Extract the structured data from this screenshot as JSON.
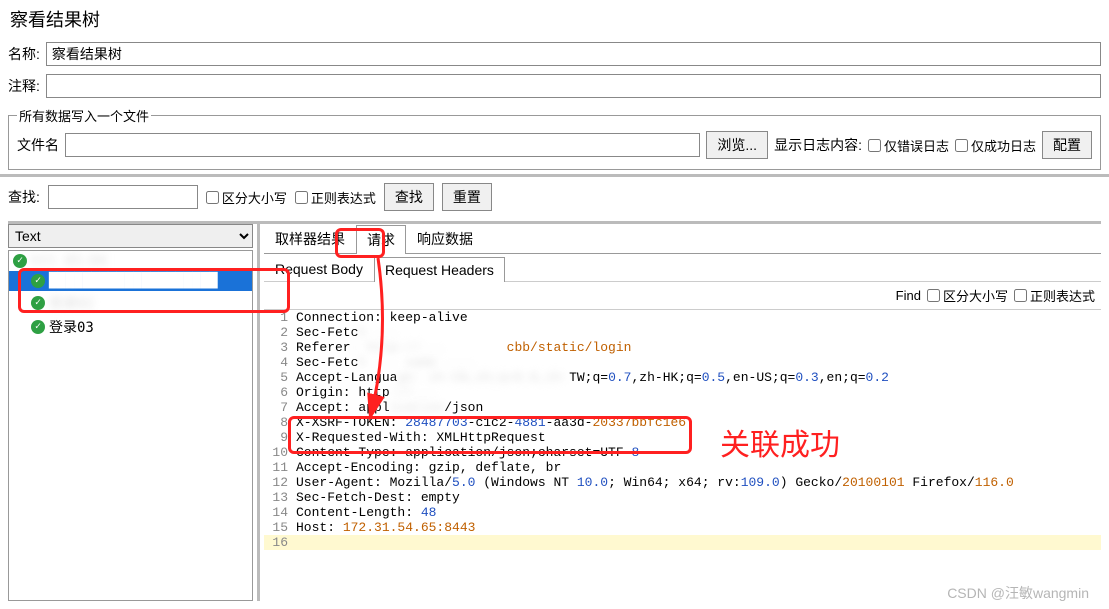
{
  "title": "察看结果树",
  "labels": {
    "name": "名称:",
    "comment": "注释:",
    "writeAll": "所有数据写入一个文件",
    "fileName": "文件名",
    "browse": "浏览...",
    "showLog": "显示日志内容:",
    "errorsOnly": "仅错误日志",
    "successOnly": "仅成功日志",
    "configure": "配置",
    "searchLabel": "查找:",
    "caseSensitive": "区分大小写",
    "regex": "正则表达式",
    "searchBtn": "查找",
    "resetBtn": "重置"
  },
  "nameValue": "察看结果树",
  "tree": {
    "renderer": "Text",
    "items": [
      {
        "label": "htt            65:84",
        "blurred": true,
        "indent": false
      },
      {
        "label": "████████████████████",
        "selected": true,
        "indent": true
      },
      {
        "label": "登录02",
        "blurred": true,
        "indent": true
      },
      {
        "label": "登录03",
        "indent": true
      }
    ]
  },
  "tabs": {
    "main": [
      "取样器结果",
      "请求",
      "响应数据"
    ],
    "mainActive": 1,
    "sub": [
      "Request Body",
      "Request Headers"
    ],
    "subActive": 1,
    "findLabel": "Find",
    "cb1": "区分大小写",
    "cb2": "正则表达式"
  },
  "annotation": "关联成功",
  "watermark": "CSDN @汪敏wangmin",
  "code": [
    {
      "n": 1,
      "segs": [
        {
          "t": "Connection: "
        },
        {
          "t": "keep-alive"
        }
      ]
    },
    {
      "n": 2,
      "segs": [
        {
          "t": "Sec-Fetc"
        },
        {
          "t": "h ...",
          "cls": "blur"
        }
      ]
    },
    {
      "n": 3,
      "segs": [
        {
          "t": "Referer"
        },
        {
          "t": ": http://...        ",
          "cls": "blur"
        },
        {
          "t": "cbb/static/login",
          "cls": "hl-orange"
        }
      ]
    },
    {
      "n": 4,
      "segs": [
        {
          "t": "Sec-Fetc"
        },
        {
          "t": "h ... same ....",
          "cls": "blur"
        }
      ]
    },
    {
      "n": 5,
      "segs": [
        {
          "t": "Accept-Langua"
        },
        {
          "t": "ge: zh-CN,zh;q=0.8,zh-",
          "cls": "blur"
        },
        {
          "t": "TW"
        },
        {
          "t": ";q=",
          "cls": ""
        },
        {
          "t": "0.7",
          "cls": "hl-blue"
        },
        {
          "t": ",zh-HK;q="
        },
        {
          "t": "0.5",
          "cls": "hl-blue"
        },
        {
          "t": ",en-US;q="
        },
        {
          "t": "0.3",
          "cls": "hl-blue"
        },
        {
          "t": ",en;q="
        },
        {
          "t": "0.2",
          "cls": "hl-blue"
        }
      ]
    },
    {
      "n": 6,
      "segs": [
        {
          "t": "Origin: http"
        },
        {
          "t": "://...",
          "cls": "blur"
        }
      ]
    },
    {
      "n": 7,
      "segs": [
        {
          "t": "Accept: appl"
        },
        {
          "t": "ication",
          "cls": "blur"
        },
        {
          "t": "/json"
        }
      ]
    },
    {
      "n": 8,
      "segs": [
        {
          "t": "X-XSRF-TOKEN: "
        },
        {
          "t": "28487703",
          "cls": "hl-blue"
        },
        {
          "t": "-c1c2-"
        },
        {
          "t": "4881",
          "cls": "hl-blue"
        },
        {
          "t": "-aa3d-"
        },
        {
          "t": "20337bbfc1e6",
          "cls": "hl-orange"
        }
      ]
    },
    {
      "n": 9,
      "segs": [
        {
          "t": "X-Requested-With: XMLHttpRequest"
        }
      ]
    },
    {
      "n": 10,
      "segs": [
        {
          "t": "Content-Type: application/json;charset=UTF-"
        },
        {
          "t": "8",
          "cls": "hl-blue"
        }
      ]
    },
    {
      "n": 11,
      "segs": [
        {
          "t": "Accept-Encoding: gzip, deflate, br"
        }
      ]
    },
    {
      "n": 12,
      "segs": [
        {
          "t": "User-Agent: Mozilla/"
        },
        {
          "t": "5.0",
          "cls": "hl-blue"
        },
        {
          "t": " (Windows NT "
        },
        {
          "t": "10.0",
          "cls": "hl-blue"
        },
        {
          "t": "; Win64; x64; rv:"
        },
        {
          "t": "109.0",
          "cls": "hl-blue"
        },
        {
          "t": ") Gecko/"
        },
        {
          "t": "20100101",
          "cls": "hl-orange"
        },
        {
          "t": " Firefox/"
        },
        {
          "t": "116.0",
          "cls": "hl-orange"
        }
      ]
    },
    {
      "n": 13,
      "segs": [
        {
          "t": "Sec-Fetch-Dest: empty"
        }
      ]
    },
    {
      "n": 14,
      "segs": [
        {
          "t": "Content-Length: "
        },
        {
          "t": "48",
          "cls": "hl-blue"
        }
      ]
    },
    {
      "n": 15,
      "segs": [
        {
          "t": "Host: "
        },
        {
          "t": "172.31.54.65:8443",
          "cls": "hl-orange"
        }
      ]
    },
    {
      "n": 16,
      "segs": [
        {
          "t": " "
        }
      ],
      "last": true
    }
  ]
}
